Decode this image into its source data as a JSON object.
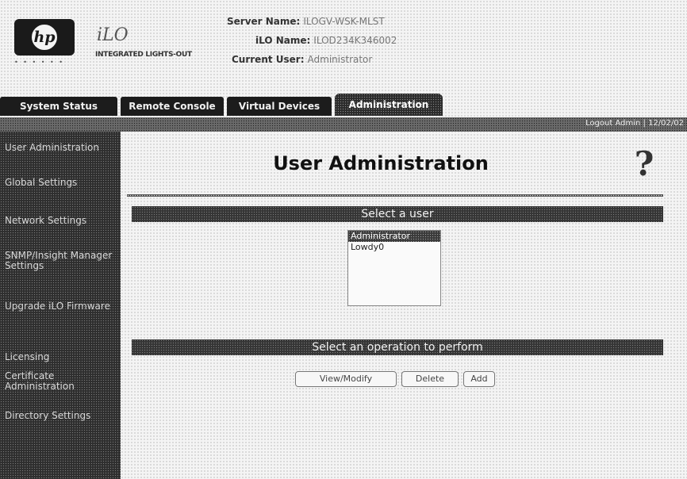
{
  "header": {
    "logo_text": "hp",
    "logo_dots": "• • • • • •",
    "product_mark": "iLO",
    "product_sub": "INTEGRATED LIGHTS-OUT",
    "server_name_label": "Server Name:",
    "server_name_value": "ILOGV-WSK-MLST",
    "ilo_name_label": "iLO Name:",
    "ilo_name_value": "ILOD234K346002",
    "current_user_label": "Current User:",
    "current_user_value": "Administrator"
  },
  "tabs": [
    {
      "label": "System Status",
      "active": false
    },
    {
      "label": "Remote Console",
      "active": false
    },
    {
      "label": "Virtual Devices",
      "active": false
    },
    {
      "label": "Administration",
      "active": true
    }
  ],
  "logout_text": "Logout Admin | 12/02/02",
  "sidebar": {
    "items": [
      {
        "label": "User Administration"
      },
      {
        "label": "Global Settings"
      },
      {
        "label": "Network Settings"
      },
      {
        "label": "SNMP/Insight Manager Settings"
      },
      {
        "label": "Upgrade iLO Firmware"
      },
      {
        "label": "Licensing"
      },
      {
        "label": "Certificate Administration"
      },
      {
        "label": "Directory Settings"
      }
    ]
  },
  "main": {
    "title": "User Administration",
    "help_icon": "?",
    "select_user_header": "Select a user",
    "users": [
      {
        "name": "Administrator",
        "selected": true
      },
      {
        "name": "Lowdy0",
        "selected": false
      }
    ],
    "select_operation_header": "Select an operation to perform",
    "buttons": {
      "view_modify": "View/Modify",
      "delete": "Delete",
      "add": "Add"
    }
  },
  "colors": {
    "tab_background": "#1c1c1c",
    "sidebar_background": "#2e2e2e",
    "section_bar": "#353535",
    "page_background": "#f4f4f4"
  }
}
